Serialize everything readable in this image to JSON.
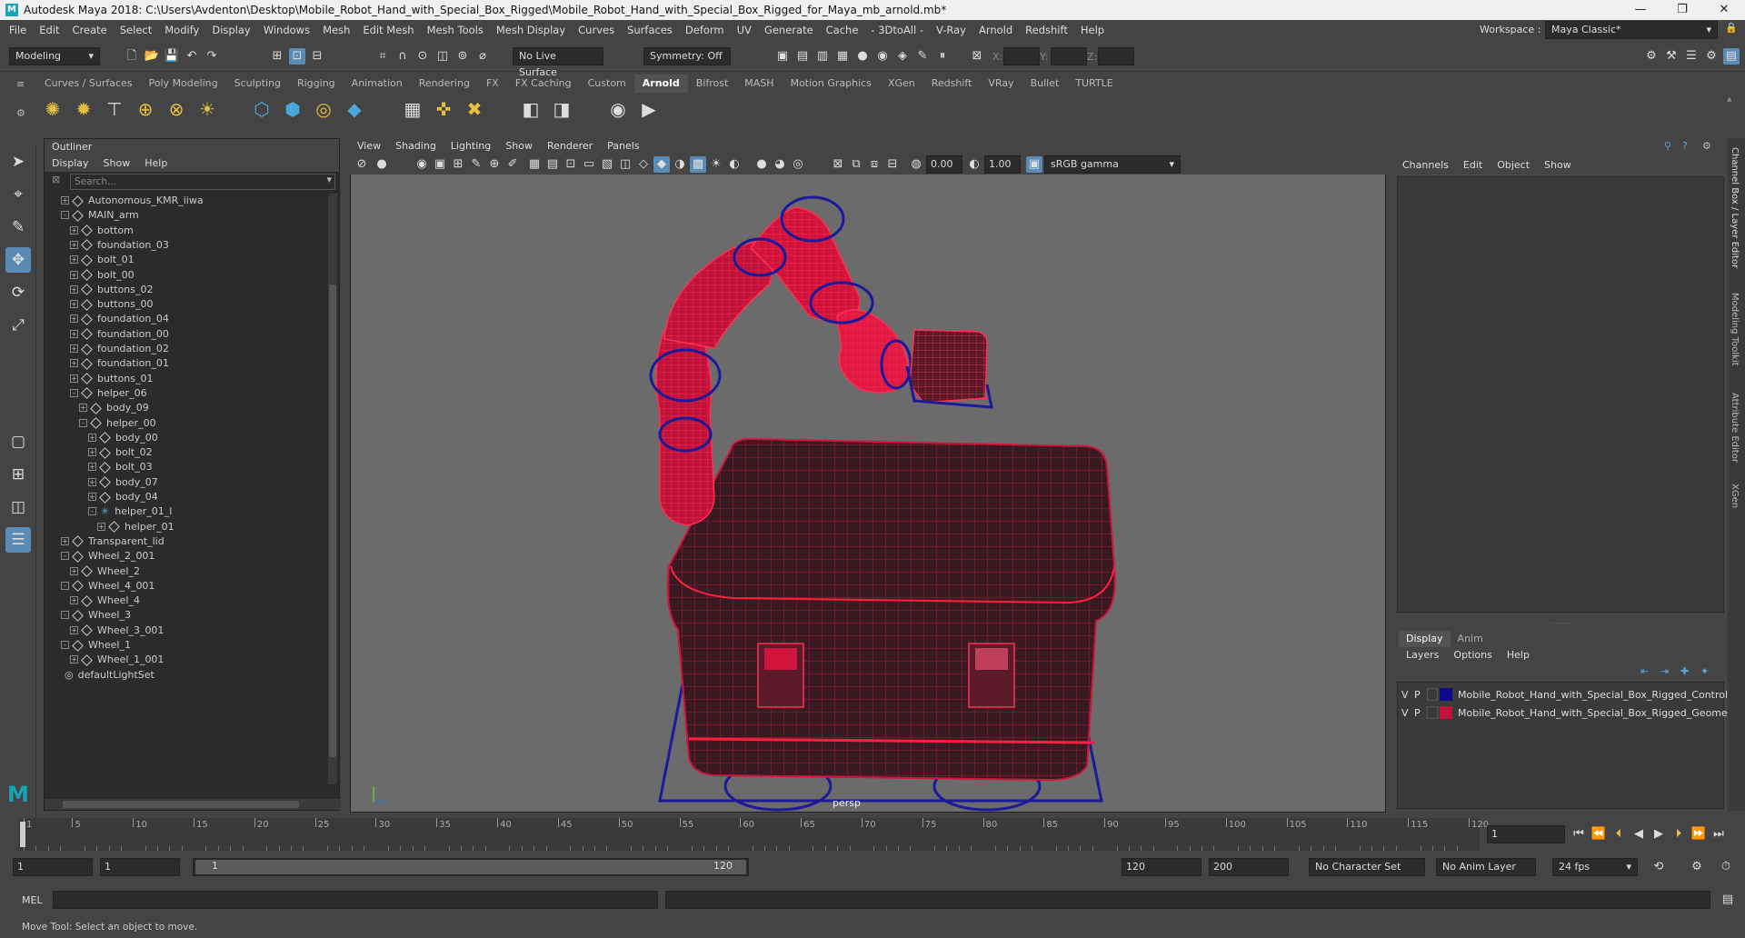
{
  "window": {
    "title": "Autodesk Maya 2018: C:\\Users\\Avdenton\\Desktop\\Mobile_Robot_Hand_with_Special_Box_Rigged\\Mobile_Robot_Hand_with_Special_Box_Rigged_for_Maya_mb_arnold.mb*",
    "logo": "M",
    "minimize": "—",
    "maximize": "❐",
    "close": "✕"
  },
  "menu": [
    "File",
    "Edit",
    "Create",
    "Select",
    "Modify",
    "Display",
    "Windows",
    "Mesh",
    "Edit Mesh",
    "Mesh Tools",
    "Mesh Display",
    "Curves",
    "Surfaces",
    "Deform",
    "UV",
    "Generate",
    "Cache",
    "- 3DtoAll -",
    "V-Ray",
    "Arnold",
    "Redshift",
    "Help"
  ],
  "workspace": {
    "label": "Workspace :",
    "value": "Maya Classic*"
  },
  "status": {
    "mode": "Modeling",
    "live_surface": "No Live Surface",
    "symmetry": "Symmetry: Off",
    "x_label": "X:",
    "y_label": "Y:",
    "z_label": "Z:"
  },
  "shelf": {
    "tabs": [
      "Curves / Surfaces",
      "Poly Modeling",
      "Sculpting",
      "Rigging",
      "Animation",
      "Rendering",
      "FX",
      "FX Caching",
      "Custom",
      "Arnold",
      "Bifrost",
      "MASH",
      "Motion Graphics",
      "XGen",
      "Redshift",
      "VRay",
      "Bullet",
      "TURTLE"
    ],
    "active": "Arnold"
  },
  "outliner": {
    "title": "Outliner",
    "menu": [
      "Display",
      "Show",
      "Help"
    ],
    "search_placeholder": "Search...",
    "items": [
      {
        "label": "Autonomous_KMR_iiwa",
        "depth": 0,
        "exp": "+"
      },
      {
        "label": "MAIN_arm",
        "depth": 0,
        "exp": "-"
      },
      {
        "label": "bottom",
        "depth": 1,
        "exp": "+"
      },
      {
        "label": "foundation_03",
        "depth": 1,
        "exp": "+"
      },
      {
        "label": "bolt_01",
        "depth": 1,
        "exp": "+"
      },
      {
        "label": "bolt_00",
        "depth": 1,
        "exp": "+"
      },
      {
        "label": "buttons_02",
        "depth": 1,
        "exp": "+"
      },
      {
        "label": "buttons_00",
        "depth": 1,
        "exp": "+"
      },
      {
        "label": "foundation_04",
        "depth": 1,
        "exp": "+"
      },
      {
        "label": "foundation_00",
        "depth": 1,
        "exp": "+"
      },
      {
        "label": "foundation_02",
        "depth": 1,
        "exp": "+"
      },
      {
        "label": "foundation_01",
        "depth": 1,
        "exp": "+"
      },
      {
        "label": "buttons_01",
        "depth": 1,
        "exp": "+"
      },
      {
        "label": "helper_06",
        "depth": 1,
        "exp": "-"
      },
      {
        "label": "body_09",
        "depth": 2,
        "exp": "+"
      },
      {
        "label": "helper_00",
        "depth": 2,
        "exp": "-"
      },
      {
        "label": "body_00",
        "depth": 3,
        "exp": "+"
      },
      {
        "label": "bolt_02",
        "depth": 3,
        "exp": "+"
      },
      {
        "label": "bolt_03",
        "depth": 3,
        "exp": "+"
      },
      {
        "label": "body_07",
        "depth": 3,
        "exp": "+"
      },
      {
        "label": "body_04",
        "depth": 3,
        "exp": "+"
      },
      {
        "label": "helper_01_l",
        "depth": 3,
        "exp": "-"
      },
      {
        "label": "helper_01",
        "depth": 4,
        "exp": "+"
      },
      {
        "label": "Transparent_lid",
        "depth": 0,
        "exp": "+"
      },
      {
        "label": "Wheel_2_001",
        "depth": 0,
        "exp": "-"
      },
      {
        "label": "Wheel_2",
        "depth": 1,
        "exp": "+"
      },
      {
        "label": "Wheel_4_001",
        "depth": 0,
        "exp": "-"
      },
      {
        "label": "Wheel_4",
        "depth": 1,
        "exp": "+"
      },
      {
        "label": "Wheel_3",
        "depth": 0,
        "exp": "-"
      },
      {
        "label": "Wheel_3_001",
        "depth": 1,
        "exp": "+"
      },
      {
        "label": "Wheel_1",
        "depth": 0,
        "exp": "-"
      },
      {
        "label": "Wheel_1_001",
        "depth": 1,
        "exp": "+"
      },
      {
        "label": "defaultLightSet",
        "depth": -1,
        "exp": ""
      }
    ]
  },
  "viewport": {
    "menu": [
      "View",
      "Shading",
      "Lighting",
      "Show",
      "Renderer",
      "Panels"
    ],
    "exposure": "0.00",
    "gamma": "1.00",
    "colorspace": "sRGB gamma",
    "camera": "persp"
  },
  "channelbox": {
    "menu": [
      "Channels",
      "Edit",
      "Object",
      "Show"
    ]
  },
  "layers": {
    "tabs": [
      "Display",
      "Anim"
    ],
    "active_tab": "Display",
    "menu": [
      "Layers",
      "Options",
      "Help"
    ],
    "rows": [
      {
        "v": "V",
        "p": "P",
        "color": "#0a0a8a",
        "name": "Mobile_Robot_Hand_with_Special_Box_Rigged_Controll"
      },
      {
        "v": "V",
        "p": "P",
        "color": "#c0143c",
        "name": "Mobile_Robot_Hand_with_Special_Box_Rigged_Geometr"
      }
    ]
  },
  "vertical_tabs": [
    "Channel Box / Layer Editor",
    "Modeling Toolkit",
    "Attribute Editor",
    "XGen"
  ],
  "timeline": {
    "ticks": [
      "1",
      "5",
      "10",
      "15",
      "20",
      "25",
      "30",
      "35",
      "40",
      "45",
      "50",
      "55",
      "60",
      "65",
      "70",
      "75",
      "80",
      "85",
      "90",
      "95",
      "100",
      "105",
      "110",
      "115",
      "120"
    ],
    "current": "1"
  },
  "range": {
    "start": "1",
    "playback_start": "1",
    "slider_start": "1",
    "slider_end": "120",
    "playback_end": "120",
    "end": "200",
    "character_set": "No Character Set",
    "anim_layer": "No Anim Layer",
    "fps": "24 fps"
  },
  "command": {
    "lang": "MEL"
  },
  "help": {
    "text": "Move Tool: Select an object to move."
  },
  "colors": {
    "wire_red": "#d0143c",
    "wire_blue": "#1a1a9a",
    "accent": "#5a8bb5"
  }
}
